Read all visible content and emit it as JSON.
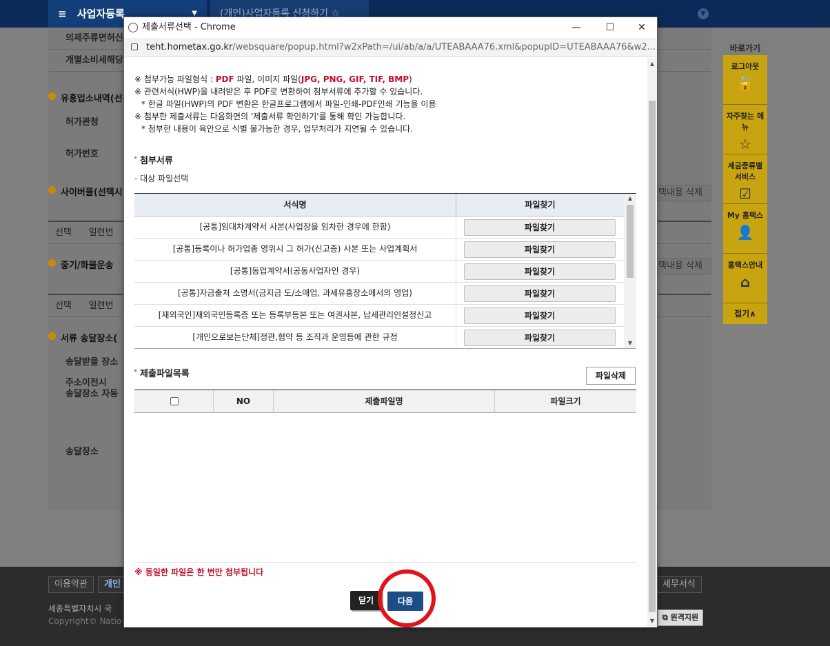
{
  "background": {
    "header_menu": "사업자등록",
    "header_tab": "(개인)사업자등록 신청하기",
    "rows": [
      "의제주류면허신",
      "개별소비세해당"
    ],
    "sections": [
      "유흥업소내역(선",
      "사이버몰(선택시",
      "중기/화물운송",
      "서류 송달장소("
    ],
    "labels": [
      "허가관청",
      "허가번호",
      "송달받을 장소",
      "주소이전시",
      "송달장소 자동",
      "송달장소"
    ],
    "table_head_1": [
      "선택",
      "일련번"
    ],
    "table_head_2": [
      "선택",
      "일련번"
    ],
    "delete_label": "택내용 삭제",
    "quick_menu": {
      "title": "바로가기",
      "items": [
        "로그아웃",
        "자주찾는 메뉴",
        "세금종류별 서비스",
        "My 홈택스",
        "홈택스안내"
      ],
      "fold": "접기∧"
    },
    "footer": {
      "btn_terms": "이용약관",
      "btn_privacy": "개인",
      "btn_tax_forms": "세무서식",
      "address": "세종특별자치시 국",
      "copyright": "Copyright© Natio",
      "remote": "원격지원"
    }
  },
  "popup": {
    "window_title": "제출서류선택 - Chrome",
    "url_host": "teht.hometax.go.kr",
    "url_path": "/websquare/popup.html?w2xPath=/ui/ab/a/a/UTEABAAA76.xml&popupID=UTEABAAA76&w2...",
    "notes": {
      "line1_prefix": "※ 첨부가능 파일형식 : ",
      "line1_pdf": "PDF",
      "line1_mid": " 파일, 이미지 파일(",
      "line1_formats": "JPG, PNG, GIF, TIF, BMP",
      "line1_suffix": ")",
      "line2": "※ 관련서식(HWP)을 내려받은 후 PDF로 변환하여 첨부서류에 추가할 수 있습니다.",
      "line3": "* 한글 파일(HWP)의 PDF 변환은 한글프로그램에서 파일-인쇄-PDF인쇄 기능을 이용",
      "line4": "※ 첨부한 제출서류는 다음화면의 '제출서류 확인하기'를 통해 확인 가능합니다.",
      "line5": "* 첨부한 내용이 육안으로 식별 불가능한 경우, 업무처리가 지연될 수 있습니다."
    },
    "attach_section_title": "첨부서류",
    "attach_subtitle": "- 대상 파일선택",
    "attach_table": {
      "headers": [
        "서식명",
        "파일찾기"
      ],
      "rows": [
        {
          "name": "[공통]임대차계약서 사본(사업장을 임차한 경우에 한함)",
          "button": "파일찾기"
        },
        {
          "name": "[공통]등록이나 허가업종 영위시 그 허가(신고증) 사본 또는 사업계획서",
          "button": "파일찾기"
        },
        {
          "name": "[공통]동업계약서(공동사업자인 경우)",
          "button": "파일찾기"
        },
        {
          "name": "[공통]자금출처 소명서(금지금 도/소매업, 과세유흥장소에서의 영업)",
          "button": "파일찾기"
        },
        {
          "name": "[재외국인]재외국민등록증 또는 등록부등본 또는 여권사본, 납세관리인설정신고",
          "button": "파일찾기"
        },
        {
          "name": "[개인으로보는단체]정관,협약 등 조직과 운영등에 관한 규정",
          "button": "파일찾기"
        }
      ]
    },
    "submit_section_title": "제출파일목록",
    "delete_file_button": "파일삭제",
    "submit_table": {
      "headers": [
        "NO",
        "제출파일명",
        "파일크기"
      ]
    },
    "warning": "※ 동일한 파일은 한 번만 첨부됩니다",
    "close_button": "닫기",
    "next_button": "다음"
  },
  "colors": {
    "accent_red": "#c0102a",
    "next_button_bg": "#1c4e86",
    "highlight_circle": "#e2131b"
  }
}
